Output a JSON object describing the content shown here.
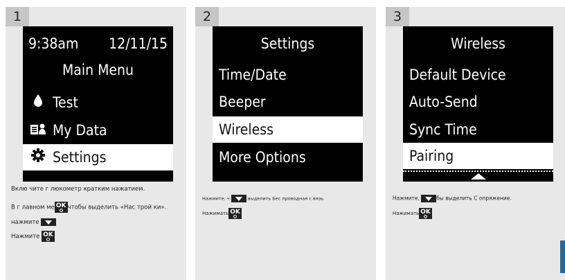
{
  "panels": [
    {
      "step": "1",
      "screen": {
        "status_time": "9:38am",
        "status_date": "12/11/15",
        "title": "Main Menu",
        "items": [
          {
            "label": "Test",
            "icon": "drop-icon"
          },
          {
            "label": "My Data",
            "icon": "data-icon"
          },
          {
            "label": "Settings",
            "icon": "gear-icon",
            "selected": true
          }
        ]
      },
      "desc": {
        "line1": "Вклю чите г люкометр кратким нажатием.",
        "line2_pre": "В г лавном ме",
        "line2_post": "чтобы выделить «Нас трой ки».",
        "line3": "нажмите",
        "line4": "Нажмите",
        "ok_label": "OK"
      }
    },
    {
      "step": "2",
      "screen": {
        "title": "Settings",
        "items": [
          {
            "label": "Time/Date"
          },
          {
            "label": "Beeper"
          },
          {
            "label": "Wireless",
            "selected": true
          },
          {
            "label": "More Options"
          }
        ]
      },
      "desc": {
        "line1_pre": "Нажмите, ч",
        "line1_post": "выделить Бес проводная с вязь.",
        "line2": "Нажимать",
        "ok_label": "OK"
      }
    },
    {
      "step": "3",
      "screen": {
        "title": "Wireless",
        "items": [
          {
            "label": "Default Device"
          },
          {
            "label": "Auto-Send"
          },
          {
            "label": "Sync Time"
          },
          {
            "label": "Pairing",
            "selected": true
          }
        ]
      },
      "desc": {
        "line1_pre": "Нажмите,",
        "line1_post": "бы выделить С опряжение.",
        "line2": "Нажимать",
        "ok_label": "OK"
      }
    }
  ]
}
